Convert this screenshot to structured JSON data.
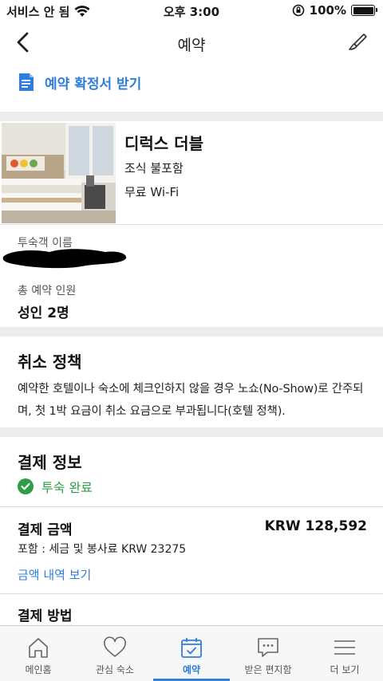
{
  "status_bar": {
    "carrier": "서비스 안 됨",
    "time": "오후 3:00",
    "battery": "100%"
  },
  "nav": {
    "title": "예약"
  },
  "confirmation": {
    "label": "예약 확정서 받기"
  },
  "room": {
    "name": "디럭스 더블",
    "meal": "조식 불포함",
    "wifi": "무료 Wi-Fi"
  },
  "guest": {
    "name_label": "투숙객 이름",
    "count_label": "총 예약 인원",
    "count_value": "성인 2명"
  },
  "cancellation": {
    "heading": "취소 정책",
    "body": "예약한 호텔이나 숙소에 체크인하지 않을 경우 노쇼(No-Show)로 간주되며, 첫 1박 요금이 취소 요금으로 부과됩니다(호텔 정책)."
  },
  "payment": {
    "heading": "결제 정보",
    "status": "투숙 완료",
    "amount_label": "결제 금액",
    "amount_value": "KRW 128,592",
    "tax_note": "포함 : 세금 및 봉사료 KRW 23275",
    "details_link": "금액 내역 보기",
    "method_label": "결제 방법"
  },
  "tabs": [
    {
      "label": "메인홈",
      "icon": "home-icon",
      "active": false
    },
    {
      "label": "관심 숙소",
      "icon": "heart-icon",
      "active": false
    },
    {
      "label": "예약",
      "icon": "calendar-check-icon",
      "active": true
    },
    {
      "label": "받은 편지함",
      "icon": "message-icon",
      "active": false
    },
    {
      "label": "더 보기",
      "icon": "menu-icon",
      "active": false
    }
  ],
  "colors": {
    "accent": "#2f7ddc",
    "success": "#2e9e4a",
    "divider": "#ececec"
  }
}
